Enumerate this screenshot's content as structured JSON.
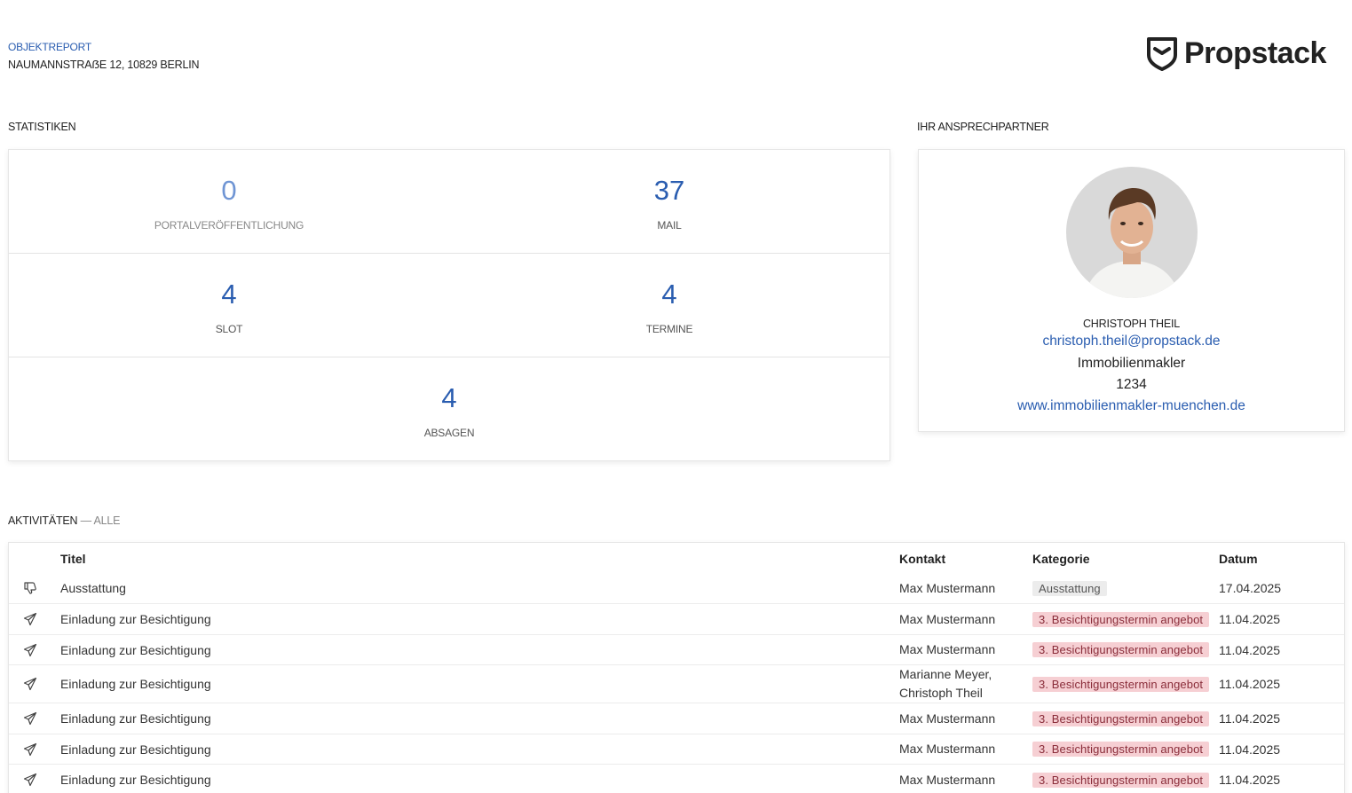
{
  "header": {
    "report_label": "OBJEKTREPORT",
    "address": "NAUMANNSTRAẞE 12, 10829 BERLIN",
    "brand_name": "Propstack"
  },
  "stats": {
    "title": "STATISTIKEN",
    "items": [
      {
        "value": "0",
        "label": "PORTALVERÖFFENTLICHUNG"
      },
      {
        "value": "37",
        "label": "MAIL"
      },
      {
        "value": "4",
        "label": "SLOT"
      },
      {
        "value": "4",
        "label": "TERMINE"
      },
      {
        "value": "4",
        "label": "ABSAGEN"
      }
    ]
  },
  "contact": {
    "title": "IHR ANSPRECHPARTNER",
    "name": "CHRISTOPH THEIL",
    "email": "christoph.theil@propstack.de",
    "role": "Immobilienmakler",
    "phone": "1234",
    "website": "www.immobilienmakler-muenchen.de"
  },
  "activities": {
    "title": "AKTIVITÄTEN",
    "filter": "— ALLE",
    "columns": {
      "title": "Titel",
      "contact": "Kontakt",
      "category": "Kategorie",
      "date": "Datum"
    },
    "rows": [
      {
        "icon": "thumbs-down-icon",
        "title": "Ausstattung",
        "contact": "Max Mustermann",
        "contact2": "",
        "category": "Ausstattung",
        "date": "17.04.2025"
      },
      {
        "icon": "paper-plane-icon",
        "title": "Einladung zur Besichtigung",
        "contact": "Max Mustermann",
        "contact2": "",
        "category": "3. Besichtigungstermin angebot",
        "date": "11.04.2025"
      },
      {
        "icon": "paper-plane-icon",
        "title": "Einladung zur Besichtigung",
        "contact": "Max Mustermann",
        "contact2": "",
        "category": "3. Besichtigungstermin angebot",
        "date": "11.04.2025"
      },
      {
        "icon": "paper-plane-icon",
        "title": "Einladung zur Besichtigung",
        "contact": "Marianne Meyer,",
        "contact2": "Christoph Theil",
        "category": "3. Besichtigungstermin angebot",
        "date": "11.04.2025"
      },
      {
        "icon": "paper-plane-icon",
        "title": "Einladung zur Besichtigung",
        "contact": "Max Mustermann",
        "contact2": "",
        "category": "3. Besichtigungstermin angebot",
        "date": "11.04.2025"
      },
      {
        "icon": "paper-plane-icon",
        "title": "Einladung zur Besichtigung",
        "contact": "Max Mustermann",
        "contact2": "",
        "category": "3. Besichtigungstermin angebot",
        "date": "11.04.2025"
      },
      {
        "icon": "paper-plane-icon",
        "title": "Einladung zur Besichtigung",
        "contact": "Max Mustermann",
        "contact2": "",
        "category": "3. Besichtigungstermin angebot",
        "date": "11.04.2025"
      }
    ]
  }
}
